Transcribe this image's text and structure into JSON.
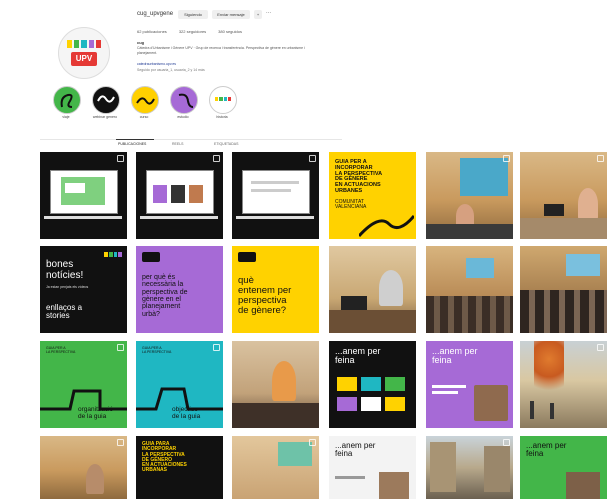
{
  "profile": {
    "username": "cug_upvgene",
    "follow_label": "Siguiendo",
    "message_label": "Enviar mensaje",
    "more_label": "···",
    "stats": [
      "62 publicaciones",
      "322 seguidores",
      "380 seguidos"
    ],
    "name": "cug",
    "bio": "Càtedra d'Urbanisme i Gènere UPV · Grup de recerca i transferència. Perspectiva de gènere en urbanisme i planejament.",
    "link": "catedraurbanismo.upv.es",
    "followed_by": "Seguido por usuaria_1, usuaria_2 y 14 más",
    "logo_text": "UPV"
  },
  "highlights": [
    {
      "label": "viaje",
      "color": "#43b649"
    },
    {
      "label": "webinar genero",
      "color": "#111111"
    },
    {
      "label": "curso",
      "color": "#ffd000"
    },
    {
      "label": "estudio",
      "color": "#a66ad6"
    },
    {
      "label": "historia",
      "color": "#ffffff"
    }
  ],
  "tabs": [
    "PUBLICACIONES",
    "REELS",
    "ETIQUETADAS"
  ],
  "grid": {
    "r2c4": [
      "GUIA PER A",
      "INCORPORAR",
      "LA PERSPECTIVA",
      "DE GÈNERE",
      "EN ACTUACIONS",
      "URBANES"
    ],
    "r2c4_sub": [
      "COMUNITAT",
      "VALENCIANA"
    ],
    "r3c1_title": [
      "bones",
      "notícies!"
    ],
    "r3c1_body": "Ja estan penjats els vídeos",
    "r3c1_cta": [
      "enllaços a",
      "stories"
    ],
    "r3c2": [
      "per què és",
      "necessària la",
      "perspectiva de",
      "gènere en el",
      "planejament",
      "urbà?"
    ],
    "r3c3": [
      "què",
      "entenem per",
      "perspectiva",
      "de gènere?"
    ],
    "r4c1_label": [
      "organització",
      "de la guia"
    ],
    "r4c2_label": [
      "objectius",
      "de la guia"
    ],
    "r4c4": [
      "...anem per",
      "feina"
    ],
    "r4c5": [
      "...anem per",
      "feina"
    ],
    "r5c2": [
      "GUIA PARA",
      "INCORPORAR",
      "LA PERSPECTIVA",
      "DE GÉNERO",
      "EN ACTUACIONES",
      "URBANAS"
    ],
    "r5c4": [
      "...anem per",
      "feina"
    ],
    "r5c6": [
      "...anem per",
      "feina"
    ]
  },
  "colors": {
    "yellow": "#ffd200",
    "green": "#43b649",
    "teal": "#1fb7c2",
    "purple": "#a66ad6",
    "black": "#111111"
  }
}
